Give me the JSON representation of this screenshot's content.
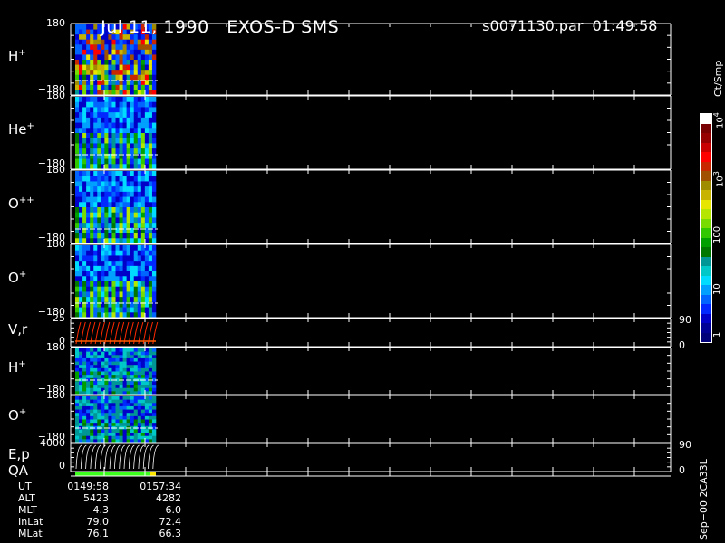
{
  "header": {
    "date": "Jul 11, 1990",
    "mission": "EXOS-D SMS",
    "file": "s0071130.par",
    "time": "01:49:58"
  },
  "colorbar": {
    "unit": "Ct/Smp",
    "ticks": [
      "1",
      "10",
      "100",
      "10^3",
      "10^4"
    ],
    "colors": [
      "#00007a",
      "#000096",
      "#0000c8",
      "#0028ff",
      "#0064ff",
      "#00a0ff",
      "#00dcff",
      "#00c8c8",
      "#009696",
      "#007800",
      "#00a000",
      "#32c800",
      "#78dc00",
      "#b4e600",
      "#e6e600",
      "#c8b400",
      "#a08c00",
      "#a05000",
      "#c82800",
      "#ff0000",
      "#c80000",
      "#960000",
      "#780000",
      "#ffffff"
    ]
  },
  "panels": [
    {
      "label": "H",
      "sup": "+",
      "ymax": "180",
      "ymin": "−180"
    },
    {
      "label": "He",
      "sup": "+",
      "ymax": "180",
      "ymin": "−180"
    },
    {
      "label": "O",
      "sup": "++",
      "ymax": "180",
      "ymin": "−180"
    },
    {
      "label": "O",
      "sup": "+",
      "ymax": "180",
      "ymin": "−180"
    },
    {
      "label": "V,r",
      "sup": "",
      "ymax": "25",
      "ymin": "0",
      "rmax": "90",
      "rmin": "0"
    },
    {
      "label": "H",
      "sup": "+",
      "ymax": "180",
      "ymin": "−180"
    },
    {
      "label": "O",
      "sup": "+",
      "ymax": "180",
      "ymin": "−180"
    },
    {
      "label": "E,p",
      "sup": "",
      "ymax": "4000",
      "ymin": "0",
      "rmax": "90",
      "rmin": "0"
    }
  ],
  "qa_label": "QA",
  "info": {
    "rows": [
      {
        "key": "UT",
        "v1": "0149:58",
        "v2": "0157:34"
      },
      {
        "key": "ALT",
        "v1": "5423",
        "v2": "4282"
      },
      {
        "key": "MLT",
        "v1": "4.3",
        "v2": "6.0"
      },
      {
        "key": "InLat",
        "v1": "79.0",
        "v2": "72.4"
      },
      {
        "key": "MLat",
        "v1": "76.1",
        "v2": "66.3"
      }
    ]
  },
  "stamp": "Sep−00 2CA33L",
  "chart_data": {
    "type": "heatmap",
    "title": "Jul 11, 1990   EXOS-D SMS",
    "panels": [
      "H+",
      "He+",
      "O++",
      "O+",
      "V,r",
      "H+",
      "O+",
      "E,p"
    ],
    "y_ranges": {
      "H+": [
        -180,
        180
      ],
      "He+": [
        -180,
        180
      ],
      "O++": [
        -180,
        180
      ],
      "O+": [
        -180,
        180
      ],
      "V,r": [
        0,
        25
      ],
      "E,p": [
        0,
        4000
      ]
    },
    "right_axis": {
      "V,r": [
        0,
        90
      ],
      "E,p": [
        0,
        90
      ]
    },
    "time_range": [
      "0149:58",
      "0157:34"
    ],
    "colorbar_unit": "Ct/Smp",
    "colorbar_scale": "log",
    "colorbar_range": [
      1,
      10000
    ],
    "data_coverage_fraction": 0.13
  }
}
